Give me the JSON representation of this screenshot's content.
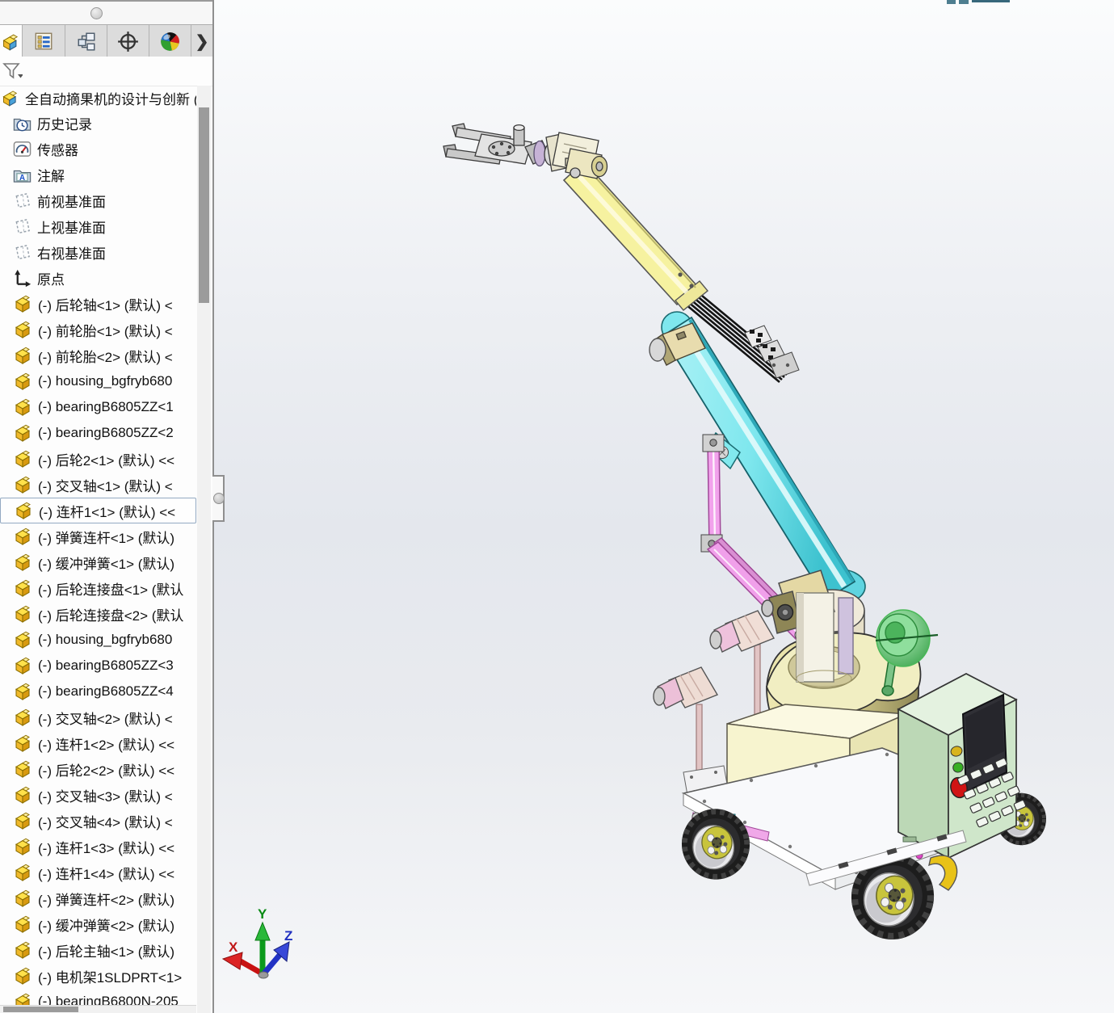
{
  "manager_panel": {
    "tabs": [
      {
        "icon": "feature-manager-tab-icon",
        "active": true
      },
      {
        "icon": "property-manager-tab-icon",
        "active": false
      },
      {
        "icon": "configuration-manager-tab-icon",
        "active": false
      },
      {
        "icon": "dimxpert-manager-tab-icon",
        "active": false
      },
      {
        "icon": "display-manager-tab-icon",
        "active": false
      }
    ],
    "overflow_arrow": "❯",
    "filter_icon": "filter-funnel-icon"
  },
  "tree": {
    "root_label": "全自动摘果机的设计与创新 (",
    "folders": [
      "历史记录",
      "传感器",
      "注解"
    ],
    "planes": [
      "前视基准面",
      "上视基准面",
      "右视基准面"
    ],
    "origin_label": "原点",
    "selected_index": 8,
    "components": [
      "(-) 后轮轴<1> (默认) <",
      "(-) 前轮胎<1> (默认) <",
      "(-) 前轮胎<2> (默认) <",
      "(-) housing_bgfryb680",
      "(-) bearingB6805ZZ<1",
      "(-) bearingB6805ZZ<2",
      "(-) 后轮2<1> (默认) <<",
      "(-) 交叉轴<1> (默认) <",
      "(-) 连杆1<1> (默认) <<",
      "(-) 弹簧连杆<1> (默认)",
      "(-) 缓冲弹簧<1> (默认)",
      "(-) 后轮连接盘<1> (默认",
      "(-) 后轮连接盘<2> (默认",
      "(-) housing_bgfryb680",
      "(-) bearingB6805ZZ<3",
      "(-) bearingB6805ZZ<4",
      "(-) 交叉轴<2> (默认) <",
      "(-) 连杆1<2> (默认) <<",
      "(-) 后轮2<2> (默认) <<",
      "(-) 交叉轴<3> (默认) <",
      "(-) 交叉轴<4> (默认) <",
      "(-) 连杆1<3> (默认) <<",
      "(-) 连杆1<4> (默认) <<",
      "(-) 弹簧连杆<2> (默认)",
      "(-) 缓冲弹簧<2> (默认)",
      "(-) 后轮主轴<1> (默认)",
      "(-) 电机架1SLDPRT<1>",
      "(-) bearingB6800N-205"
    ]
  },
  "viewport": {
    "triad": {
      "x": "X",
      "y": "Y",
      "z": "Z"
    },
    "colors": {
      "arm_upper": "#f6f2a0",
      "arm_lower": "#7fe7ee",
      "links": "#f2a2ec",
      "housing_top": "#f1eec2",
      "control_box": "#cfe6ca",
      "dish": "#4ab858",
      "button_red": "#d01414",
      "button_green": "#38b024",
      "button_yellow": "#d8b41c",
      "wheel_hub": "#c8c43c"
    }
  }
}
